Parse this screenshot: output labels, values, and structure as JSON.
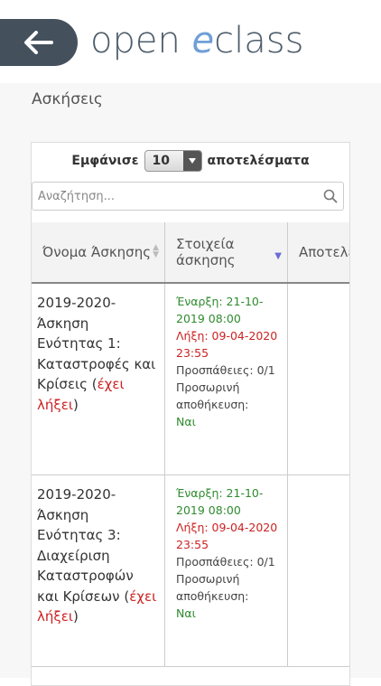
{
  "header": {
    "logo_prefix": "open ",
    "logo_e": "e",
    "logo_suffix": "class"
  },
  "page": {
    "title": "Ασκήσεις"
  },
  "table_controls": {
    "show_label": "Εμφάνισε",
    "page_length": "10",
    "results_label": "αποτελέσματα",
    "search_placeholder": "Αναζήτηση..."
  },
  "columns": {
    "name": "Όνομα Άσκησης",
    "details": "Στοιχεία άσκησης",
    "results": "Αποτελέσματα"
  },
  "rows": [
    {
      "name": "2019-2020-Άσκηση Ενότητας 1: Καταστροφές και Κρίσεις",
      "expired": "έχει λήξει",
      "start": "Έναρξη: 21-10-2019 08:00",
      "end": "Λήξη: 09-04-2020 23:55",
      "attempts": "Προσπάθειες: 0/1",
      "temp_save_label": "Προσωρινή αποθήκευση:",
      "temp_save_value": "Ναι",
      "result": "-"
    },
    {
      "name": "2019-2020-Άσκηση Ενότητας 3: Διαχείριση Καταστροφών και Κρίσεων",
      "expired": "έχει λήξει",
      "start": "Έναρξη: 21-10-2019 08:00",
      "end": "Λήξη: 09-04-2020 23:55",
      "attempts": "Προσπάθειες: 0/1",
      "temp_save_label": "Προσωρινή αποθήκευση:",
      "temp_save_value": "Ναι",
      "result": "-"
    }
  ]
}
